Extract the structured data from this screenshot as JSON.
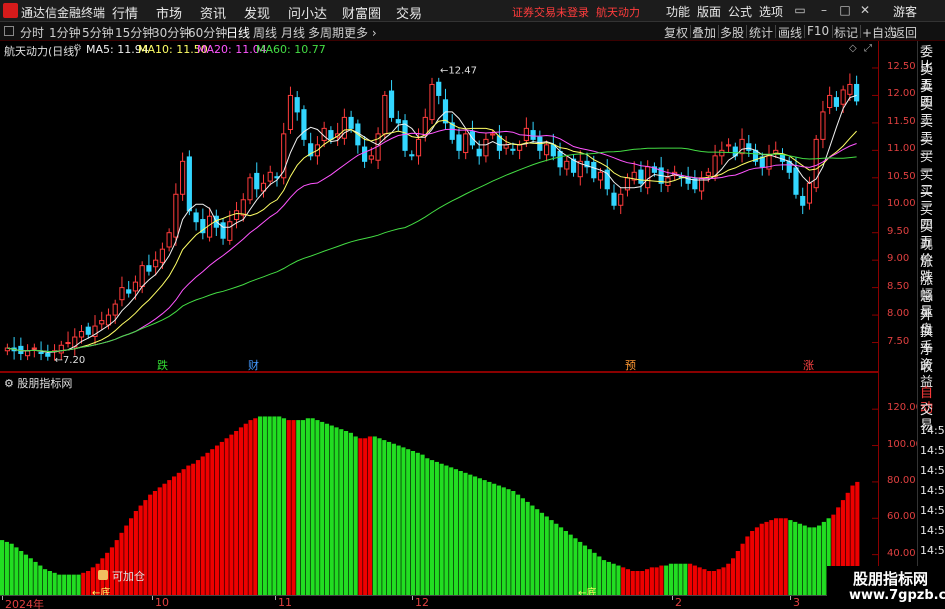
{
  "titlebar": {
    "app_name": "通达信金融终端",
    "menus": [
      "行情",
      "市场",
      "资讯",
      "发现",
      "问小达",
      "财富圈",
      "交易"
    ],
    "warning": "证券交易未登录",
    "current_stock": "航天动力",
    "right_menus": [
      "功能",
      "版面",
      "公式",
      "选项"
    ],
    "user": "游客"
  },
  "toolbar": {
    "periods": [
      "分时",
      "1分钟",
      "5分钟",
      "15分钟",
      "30分钟",
      "60分钟",
      "日线",
      "周线",
      "月线",
      "多周期",
      "更多"
    ],
    "active_period": "日线",
    "right_buttons": [
      "复权",
      "叠加",
      "多股",
      "统计",
      "画线",
      "F10",
      "标记",
      "+自选",
      "返回"
    ]
  },
  "main_chart": {
    "stock_label": "航天动力(日线)",
    "ma_legend": [
      {
        "label": "MA5: 11.94",
        "color": "#f0f0f0"
      },
      {
        "label": "MA10: 11.50",
        "color": "#ffff66"
      },
      {
        "label": "MA20: 11.04",
        "color": "#ff55ff"
      },
      {
        "label": "MA60: 10.77",
        "color": "#44dd44"
      }
    ],
    "high_marker": "12.47",
    "low_marker": "7.20",
    "events": [
      {
        "label": "跌",
        "color": "#33dd33"
      },
      {
        "label": "财",
        "color": "#4499ff"
      },
      {
        "label": "预",
        "color": "#ff9933"
      },
      {
        "label": "涨",
        "color": "#ff4444"
      }
    ]
  },
  "indicator": {
    "title": "股朋指标网",
    "buy_label": "可加仓",
    "bottom_label_1": "底",
    "bottom_label_2": "底"
  },
  "dates": {
    "labels": [
      "2024年",
      "10",
      "11",
      "12",
      "2",
      "3"
    ]
  },
  "right_panel": {
    "items": [
      "委比",
      "卖五",
      "卖四",
      "卖三",
      "卖二",
      "卖一",
      "买一",
      "买二",
      "买三",
      "买四",
      "买五",
      "现价",
      "涨跌",
      "涨幅",
      "总量",
      "外盘",
      "换手",
      "净资",
      "收益"
    ],
    "lower_items": [
      "自动",
      "交易"
    ],
    "times": [
      "14:56",
      "14:56",
      "14:56",
      "14:56",
      "14:56",
      "14:56",
      "14:56"
    ]
  },
  "watermark": {
    "title": "股朋指标网",
    "url": "www.7gpzb.com"
  },
  "chart_data": [
    {
      "type": "candlestick",
      "title": "航天动力(日线)",
      "ylim": [
        7.2,
        12.7
      ],
      "yticks": [
        7.5,
        8.0,
        8.5,
        9.0,
        9.5,
        10.0,
        10.5,
        11.0,
        11.5,
        12.0,
        12.5
      ],
      "closes": [
        7.4,
        7.35,
        7.3,
        7.35,
        7.4,
        7.3,
        7.25,
        7.35,
        7.45,
        7.5,
        7.6,
        7.7,
        7.65,
        7.8,
        7.9,
        8.0,
        8.2,
        8.5,
        8.4,
        8.6,
        8.9,
        8.8,
        9.0,
        9.2,
        9.5,
        10.2,
        10.8,
        9.9,
        9.7,
        9.5,
        9.8,
        9.6,
        9.4,
        9.7,
        9.9,
        10.1,
        10.5,
        10.3,
        10.4,
        10.6,
        10.5,
        11.3,
        12.0,
        11.7,
        11.2,
        10.9,
        11.1,
        11.4,
        11.2,
        11.3,
        11.6,
        11.4,
        11.1,
        10.8,
        10.9,
        11.3,
        12.0,
        11.6,
        11.5,
        11.0,
        10.9,
        11.2,
        11.6,
        12.2,
        12.0,
        11.5,
        11.2,
        11.0,
        11.3,
        11.1,
        10.9,
        11.2,
        11.3,
        11.0,
        11.1,
        11.0,
        11.1,
        11.4,
        11.2,
        11.0,
        11.1,
        10.9,
        10.7,
        10.8,
        10.6,
        10.8,
        10.7,
        10.5,
        10.6,
        10.3,
        10.0,
        10.2,
        10.5,
        10.6,
        10.4,
        10.7,
        10.6,
        10.4,
        10.5,
        10.6,
        10.5,
        10.4,
        10.3,
        10.5,
        10.6,
        10.9,
        11.0,
        11.1,
        10.9,
        11.2,
        11.0,
        10.8,
        10.7,
        10.9,
        11.0,
        10.8,
        10.6,
        10.2,
        10.0,
        10.4,
        11.2,
        11.7,
        12.0,
        11.8,
        12.1,
        12.2,
        11.9
      ],
      "ma": [
        "MA5",
        "MA10",
        "MA20",
        "MA60"
      ]
    },
    {
      "type": "bar",
      "title": "股朋指标网",
      "ylim": [
        20,
        130
      ],
      "yticks": [
        20,
        40,
        60,
        80,
        100,
        120
      ],
      "values": [
        48,
        47,
        46,
        44,
        42,
        40,
        38,
        36,
        34,
        32,
        31,
        30,
        29,
        29,
        29,
        29,
        29,
        30,
        31,
        33,
        35,
        38,
        41,
        44,
        48,
        52,
        56,
        60,
        64,
        67,
        70,
        73,
        75,
        77,
        79,
        81,
        83,
        85,
        87,
        89,
        90,
        92,
        94,
        96,
        98,
        100,
        102,
        104,
        106,
        108,
        110,
        112,
        114,
        115,
        116,
        116,
        116,
        116,
        116,
        115,
        114,
        114,
        114,
        114,
        115,
        115,
        114,
        113,
        112,
        111,
        110,
        109,
        108,
        107,
        105,
        104,
        104,
        105,
        105,
        104,
        103,
        102,
        101,
        100,
        99,
        98,
        97,
        96,
        95,
        93,
        92,
        91,
        90,
        89,
        88,
        87,
        86,
        85,
        84,
        83,
        82,
        81,
        80,
        79,
        78,
        77,
        76,
        75,
        73,
        71,
        69,
        67,
        65,
        63,
        61,
        59,
        57,
        55,
        53,
        51,
        49,
        47,
        45,
        43,
        41,
        39,
        37,
        36,
        35,
        34,
        33,
        32,
        31,
        31,
        31,
        32,
        33,
        33,
        34,
        34,
        35,
        35,
        35,
        35,
        35,
        34,
        33,
        32,
        31,
        31,
        32,
        33,
        35,
        38,
        42,
        46,
        50,
        53,
        55,
        57,
        58,
        59,
        60,
        60,
        60,
        59,
        58,
        57,
        56,
        55,
        55,
        56,
        58,
        60,
        62,
        66,
        70,
        74,
        78,
        80
      ],
      "colors": [
        "g",
        "g",
        "g",
        "g",
        "g",
        "g",
        "g",
        "g",
        "g",
        "g",
        "g",
        "g",
        "g",
        "g",
        "g",
        "g",
        "g",
        "r",
        "r",
        "r",
        "r",
        "r",
        "r",
        "r",
        "r",
        "r",
        "r",
        "r",
        "r",
        "r",
        "r",
        "r",
        "r",
        "r",
        "r",
        "r",
        "r",
        "r",
        "r",
        "r",
        "r",
        "r",
        "r",
        "r",
        "r",
        "r",
        "r",
        "r",
        "r",
        "r",
        "r",
        "r",
        "r",
        "r",
        "g",
        "g",
        "g",
        "g",
        "g",
        "g",
        "r",
        "r",
        "g",
        "g",
        "g",
        "g",
        "g",
        "g",
        "g",
        "g",
        "g",
        "g",
        "g",
        "g",
        "g",
        "r",
        "r",
        "r",
        "g",
        "g",
        "g",
        "g",
        "g",
        "g",
        "g",
        "g",
        "g",
        "g",
        "g",
        "g",
        "g",
        "g",
        "g",
        "g",
        "g",
        "g",
        "g",
        "g",
        "g",
        "g",
        "g",
        "g",
        "g",
        "g",
        "g",
        "g",
        "g",
        "g",
        "g",
        "g",
        "g",
        "g",
        "g",
        "g",
        "g",
        "g",
        "g",
        "g",
        "g",
        "g",
        "g",
        "g",
        "g",
        "g",
        "g",
        "g",
        "g",
        "g",
        "g",
        "g",
        "r",
        "r",
        "r",
        "r",
        "r",
        "r",
        "r",
        "r",
        "r",
        "g",
        "g",
        "g",
        "g",
        "g",
        "r",
        "r",
        "r",
        "r",
        "r",
        "r",
        "r",
        "r",
        "r",
        "r",
        "r",
        "r",
        "r",
        "r",
        "r",
        "r",
        "r",
        "r",
        "r",
        "r",
        "r",
        "g",
        "g",
        "g",
        "g",
        "g",
        "g",
        "g",
        "g",
        "g",
        "r",
        "r",
        "r",
        "r",
        "r",
        "r",
        "r",
        "r",
        "r"
      ]
    }
  ]
}
